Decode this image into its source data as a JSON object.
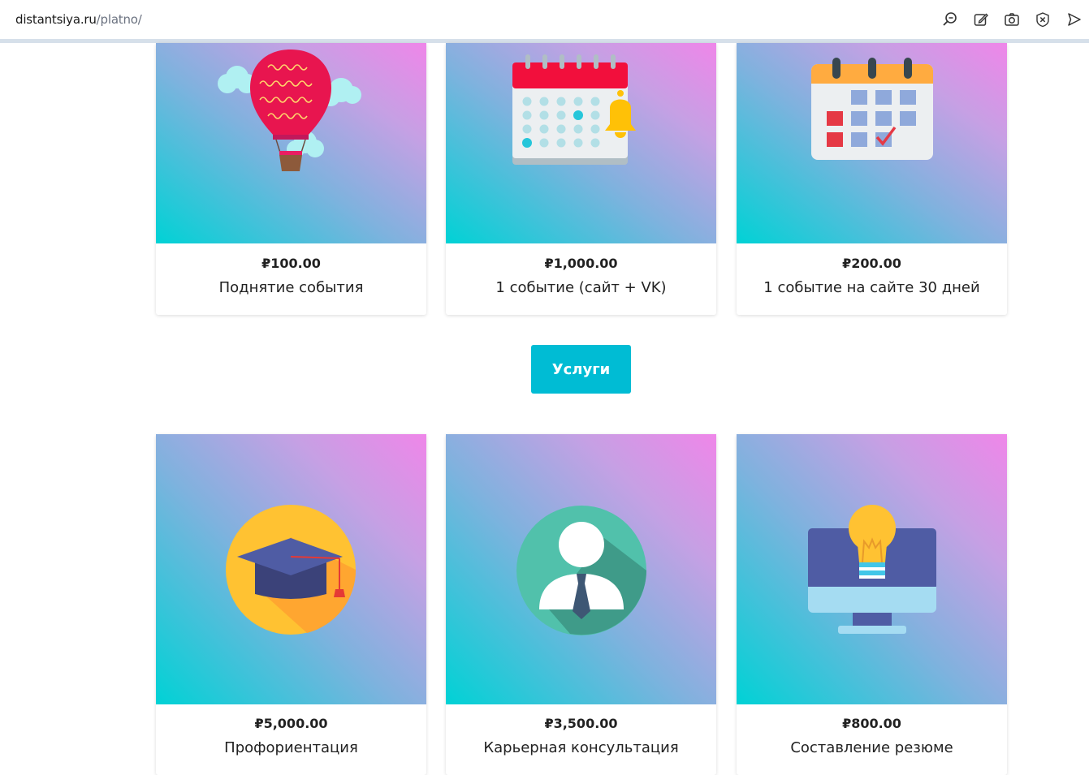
{
  "browser": {
    "url_domain": "distantsiya.ru",
    "url_path": "/platno/",
    "icons": [
      "zoom-icon",
      "edit-icon",
      "camera-icon",
      "close-circle-icon",
      "send-icon"
    ]
  },
  "section_button": {
    "label": "Услуги"
  },
  "top_cards": [
    {
      "price": "₽100.00",
      "title": "Поднятие события",
      "icon": "hot-air-balloon-icon"
    },
    {
      "price": "₽1,000.00",
      "title": "1 событие (сайт + VK)",
      "icon": "calendar-bell-icon"
    },
    {
      "price": "₽200.00",
      "title": "1 событие на сайте 30 дней",
      "icon": "calendar-check-icon"
    }
  ],
  "service_cards": [
    {
      "price": "₽5,000.00",
      "title": "Профориентация",
      "icon": "graduation-cap-icon"
    },
    {
      "price": "₽3,500.00",
      "title": "Карьерная консультация",
      "icon": "user-consultant-icon"
    },
    {
      "price": "₽800.00",
      "title": "Составление резюме",
      "icon": "monitor-lightbulb-icon"
    }
  ],
  "colors": {
    "button": "#00bcd4",
    "gradient_start": "#00d2d5",
    "gradient_end": "#ef86e9"
  }
}
